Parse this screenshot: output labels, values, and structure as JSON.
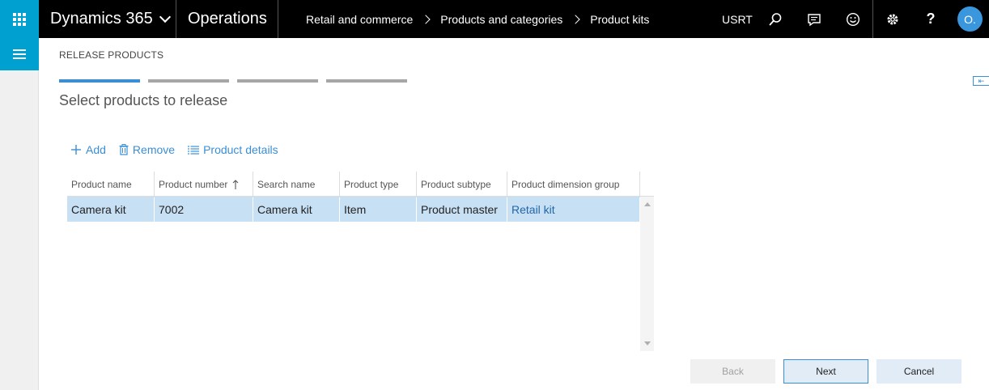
{
  "header": {
    "brand": "Dynamics 365",
    "module": "Operations",
    "breadcrumbs": [
      "Retail and commerce",
      "Products and categories",
      "Product kits"
    ],
    "company": "USRT",
    "avatar_initial": "O."
  },
  "dialog": {
    "title": "RELEASE PRODUCTS",
    "step_heading": "Select products to release",
    "steps_total": 4,
    "active_step": 1
  },
  "actions": {
    "add": "Add",
    "remove": "Remove",
    "product_details": "Product details"
  },
  "grid": {
    "columns": [
      "Product name",
      "Product number",
      "Search name",
      "Product type",
      "Product subtype",
      "Product dimension group"
    ],
    "sorted_column": "Product number",
    "rows": [
      {
        "product_name": "Camera kit",
        "product_number": "7002",
        "search_name": "Camera kit",
        "product_type": "Item",
        "product_subtype": "Product master",
        "product_dimension_group": "Retail kit"
      }
    ]
  },
  "buttons": {
    "back": "Back",
    "next": "Next",
    "cancel": "Cancel"
  },
  "colors": {
    "waffle_bg": "#00a1d0",
    "accent": "#3a8ed4",
    "selected_row": "#c7e0f4",
    "link": "#2266a8"
  }
}
